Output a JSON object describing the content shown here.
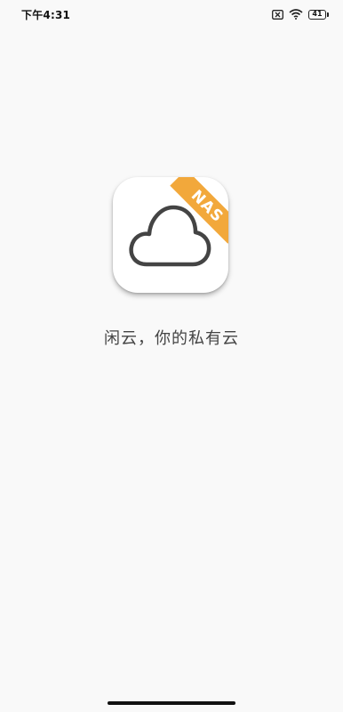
{
  "status_bar": {
    "time": "下午4:31",
    "battery_level": "41",
    "icons": [
      "sim-none-icon",
      "wifi-icon",
      "battery-icon"
    ]
  },
  "app": {
    "badge": "NAS",
    "tagline": "闲云，你的私有云",
    "icon": "cloud-icon",
    "accent_color": "#f2a83b",
    "background_color": "#f9f9f9"
  }
}
